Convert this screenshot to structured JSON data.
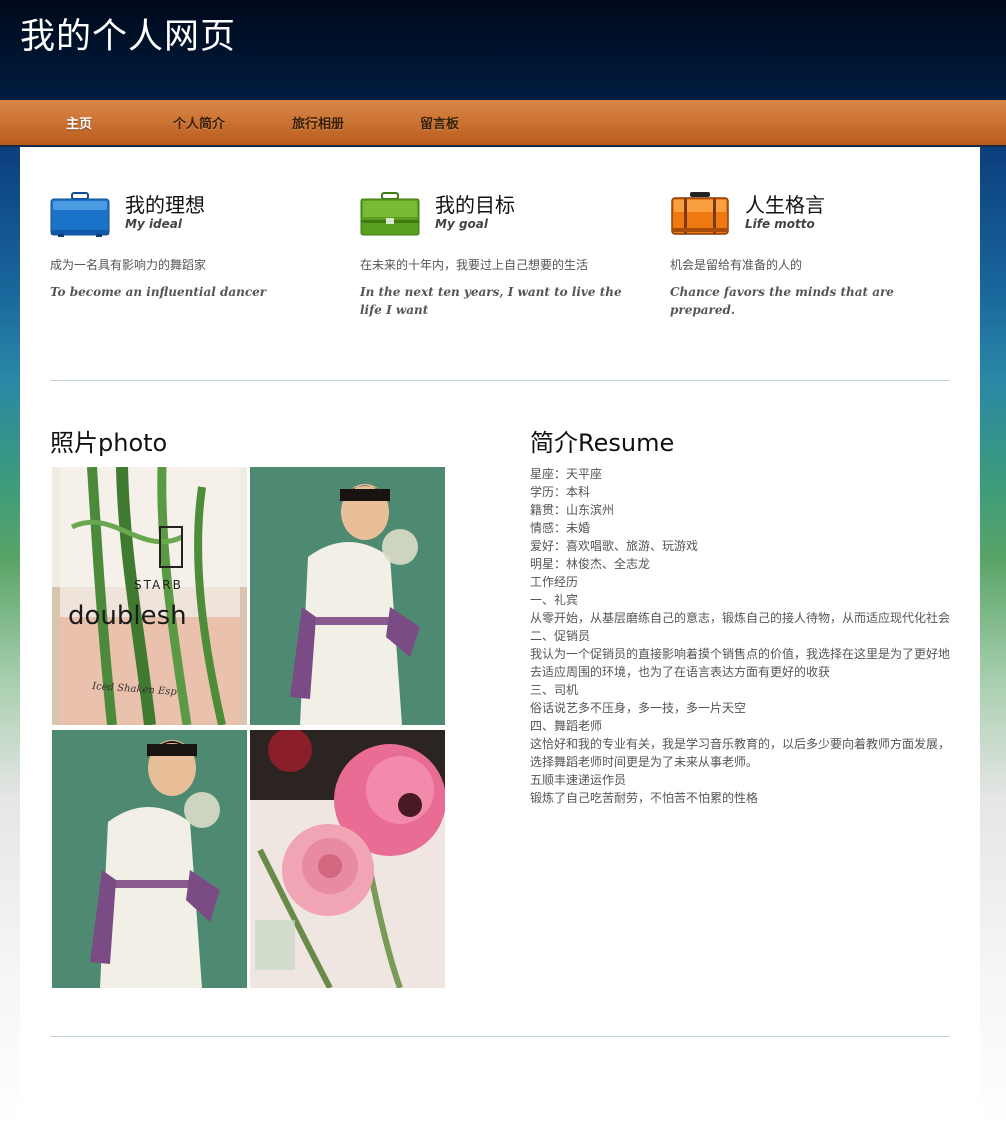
{
  "site": {
    "title": "我的个人网页"
  },
  "nav": {
    "items": [
      "主页",
      "个人简介",
      "旅行相册",
      "留言板"
    ],
    "active_index": 0
  },
  "features": [
    {
      "icon": "blue-briefcase-icon",
      "title": "我的理想",
      "subtitle": "My ideal",
      "text_cn": "成为一名具有影响力的舞蹈家",
      "text_en": "To become an influential dancer",
      "color": "#1a73c8"
    },
    {
      "icon": "green-briefcase-icon",
      "title": "我的目标",
      "subtitle": "My goal",
      "text_cn": "在未来的十年内，我要过上自己想要的生活",
      "text_en": "In the next ten years, I want to live the life I want",
      "color": "#5aa020"
    },
    {
      "icon": "orange-suitcase-icon",
      "title": "人生格言",
      "subtitle": "Life motto",
      "text_cn": "机会是留给有准备的人的",
      "text_en": "Chance favors the minds that are prepared.",
      "color": "#f07810"
    }
  ],
  "photos": {
    "title": "照片photo",
    "items": [
      {
        "name": "flower-vase-glass-photo",
        "glass_top_text": "STARB",
        "glass_main_text": "doublesh",
        "glass_script_text": "Iced Shaken Esp"
      },
      {
        "name": "portrait-photo-1"
      },
      {
        "name": "portrait-photo-2"
      },
      {
        "name": "pink-flowers-photo"
      }
    ]
  },
  "resume": {
    "title": "简介Resume",
    "lines": [
      "星座：天平座",
      "学历：本科",
      "籍贯：山东滨州",
      "情感：未婚",
      "爱好：喜欢唱歌、旅游、玩游戏",
      "明星：林俊杰、全志龙",
      "工作经历",
      "一、礼宾",
      "从零开始，从基层磨练自己的意志，锻炼自己的接人待物，从而适应现代化社会",
      "二、促销员",
      "我认为一个促销员的直接影响着摸个销售点的价值，我选择在这里是为了更好地",
      "去适应周围的环境，也为了在语言表达方面有更好的收获",
      "三、司机",
      "俗话说艺多不压身，多一技，多一片天空",
      "四、舞蹈老师",
      "这恰好和我的专业有关，我是学习音乐教育的，以后多少要向着教师方面发展，",
      "选择舞蹈老师时间更是为了未来从事老师。",
      "五顺丰速递运作员",
      "锻炼了自己吃苦耐劳，不怕苦不怕累的性格"
    ]
  }
}
